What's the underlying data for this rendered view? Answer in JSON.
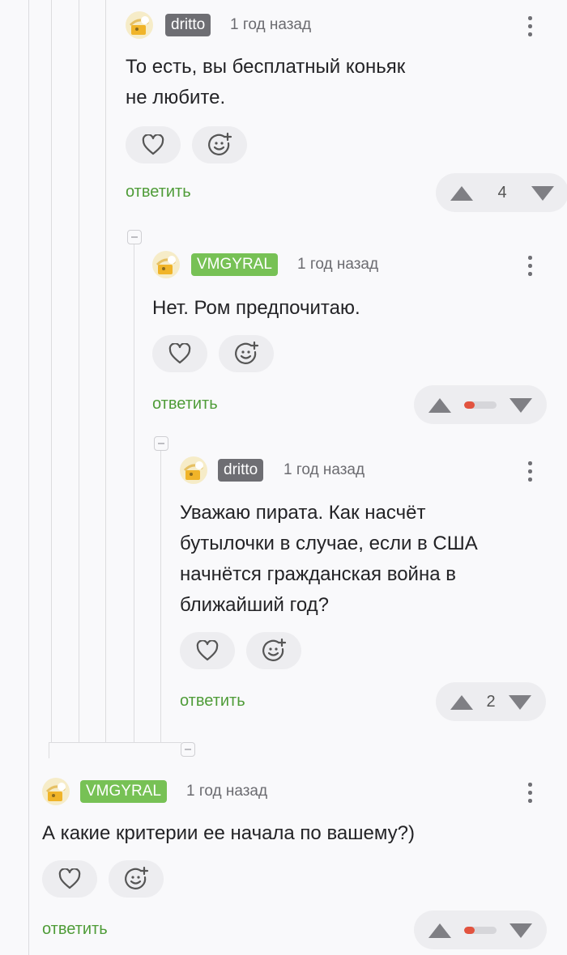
{
  "icons": {
    "like": "heart-outline-icon",
    "react": "smile-plus-icon",
    "menu": "more-vertical-icon",
    "vote_up": "triangle-up-icon",
    "vote_down": "triangle-down-icon",
    "collapse": "collapse-minus-icon"
  },
  "colors": {
    "reply": "#4f9c38",
    "username_gray": "#6e6e73",
    "username_green": "#77c155",
    "ratio_negative": "#e2533f"
  },
  "comments": [
    {
      "username": "dritto",
      "time": "1 год назад",
      "text_lines": [
        "То есть, вы бесплатный коньяк",
        "не любите."
      ],
      "reply_label": "ответить",
      "score": "4"
    },
    {
      "username": "VMGYRAL",
      "time": "1 год назад",
      "text_lines": [
        "Нет. Ром предпочитаю."
      ],
      "reply_label": "ответить",
      "score": null,
      "negative_ratio": 0.33
    },
    {
      "username": "dritto",
      "time": "1 год назад",
      "text_lines": [
        "Уважаю пирата. Как насчёт",
        "бутылочки в случае, если в США",
        "начнётся гражданская война в",
        "ближайший год?"
      ],
      "reply_label": "ответить",
      "score": "2"
    },
    {
      "username": "VMGYRAL",
      "time": "1 год назад",
      "text_lines": [
        "А какие критерии ее начала по вашему?)"
      ],
      "reply_label": "ответить",
      "score": null,
      "negative_ratio": 0.33
    }
  ]
}
